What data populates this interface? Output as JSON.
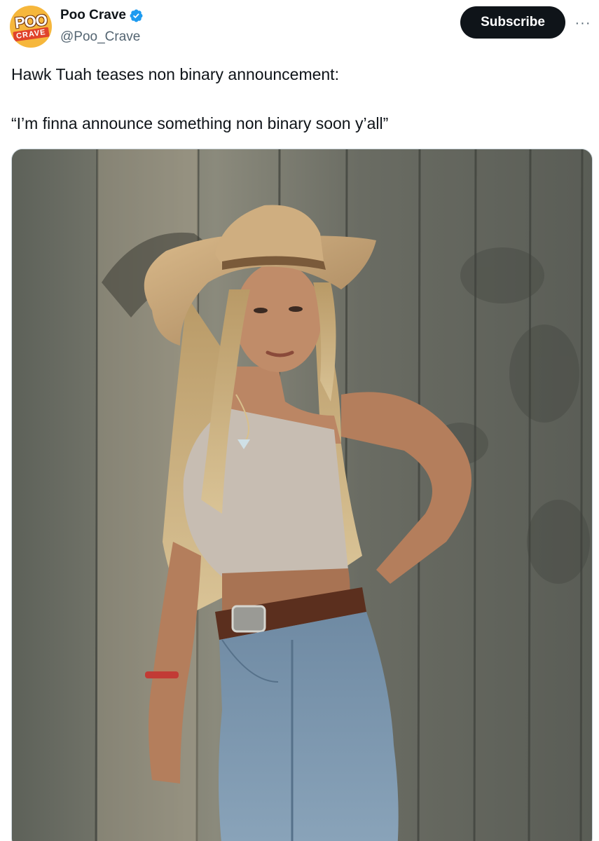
{
  "author": {
    "display_name": "Poo Crave",
    "handle": "@Poo_Crave",
    "avatar_text_top": "POO",
    "avatar_text_bottom": "CRAVE",
    "verified": true,
    "verified_color": "#1d9bf0"
  },
  "actions": {
    "subscribe_label": "Subscribe",
    "more_icon": "more-horizontal-icon"
  },
  "tweet": {
    "line1": "Hawk Tuah teases non binary announcement:",
    "line2": "“I’m finna announce something non binary soon y’all”"
  },
  "media": {
    "kind": "photo",
    "description_icon": "photo-woman-cowboy-hat-icon"
  },
  "colors": {
    "button_bg": "#0f1419",
    "text_primary": "#0f1419",
    "text_secondary": "#536471",
    "avatar_bg": "#f6b73c"
  }
}
